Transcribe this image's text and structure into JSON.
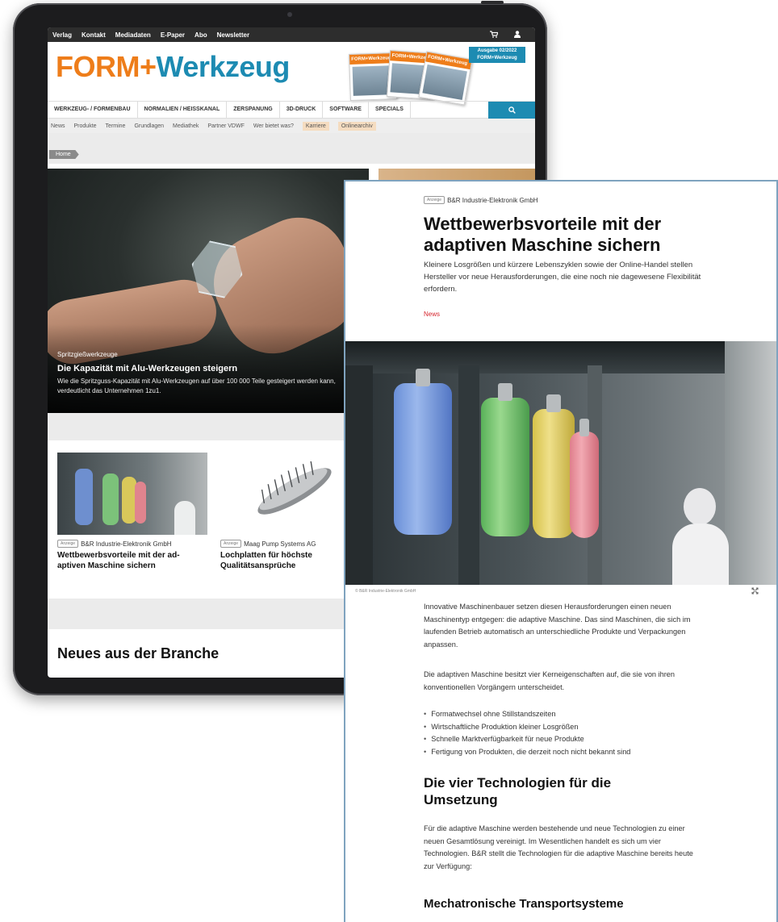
{
  "site": {
    "topnav": [
      "Verlag",
      "Kontakt",
      "Mediadaten",
      "E-Paper",
      "Abo",
      "Newsletter"
    ],
    "cart_icon": "cart-icon",
    "user_icon": "user-icon",
    "logo_form": "FORM+",
    "logo_werkzeug": "Werkzeug",
    "magazine_title": "FORM+Werkzeug",
    "issue_line1": "Ausgabe 02/2022",
    "issue_line2": "FORM+Werkzeug",
    "mainnav": [
      "WERKZEUG- / FORMENBAU",
      "NORMALIEN / HEISSKANAL",
      "ZERSPANUNG",
      "3D-DRUCK",
      "SOFTWARE",
      "SPECIALS"
    ],
    "search_icon": "search-icon",
    "subnav": [
      "News",
      "Produkte",
      "Termine",
      "Grundlagen",
      "Mediathek",
      "Partner VDWF",
      "Wer bietet was?",
      "Karriere",
      "Onlinearchiv"
    ],
    "breadcrumb": "Home",
    "hero": {
      "category": "Spritzgießwerkzeuge",
      "title": "Die Kapazität mit Alu-Werkzeugen steigern",
      "desc": "Wie die Spritzguss-Kapazität mit Alu-Werkzeugen auf über 100 000 Teile gesteigert werden kann, verdeutlicht das Unternehmen 1zu1."
    },
    "cards": [
      {
        "tag": "Anzeige",
        "company": "B&R Industrie-Elektronik GmbH",
        "title": "Wettbewerbsvorteile mit der ad-aptiven Maschine sichern"
      },
      {
        "tag": "Anzeige",
        "company": "Maag Pump Systems AG",
        "title": "Lochplatten für höchste Qualitätsansprüche"
      }
    ],
    "section_title": "Neues aus der Branche"
  },
  "article": {
    "tag": "Anzeige",
    "company": "B&R Industrie-Elektronik GmbH",
    "title": "Wettbewerbsvorteile mit der adaptiven Maschine sichern",
    "lead": "Kleinere Losgrößen und kürzere Lebenszyklen sowie der Online-Handel stellen Hersteller vor neue Herausforderungen, die eine noch nie dagewesene Flexibilität erfordern.",
    "category": "News",
    "image_credit": "© B&R Industrie-Elektronik GmbH",
    "expand_icon": "expand-icon",
    "p1": "Innovative Maschinenbauer setzen diesen Herausforderungen einen neuen Maschinentyp entgegen: die adaptive Maschine. Das sind Maschinen, die sich im laufenden Betrieb automatisch an unterschiedliche Produkte und Verpackungen anpassen.",
    "p2": "Die adaptiven Maschine besitzt vier Kerneigenschaften auf, die sie von ihren konventionellen Vorgängern unterscheidet.",
    "bullets": [
      "Formatwechsel ohne Stillstandszeiten",
      "Wirtschaftliche Produktion kleiner Losgrößen",
      "Schnelle Marktverfügbarkeit für neue Produkte",
      "Fertigung von Produkten, die derzeit noch nicht bekannt sind"
    ],
    "h2": "Die vier Technologien für die Umsetzung",
    "p3": "Für die adaptive Maschine werden bestehende und neue Technologien zu einer neuen Gesamtlösung vereinigt. Im Wesentlichen handelt es sich um vier Technologien. B&R stellt die Technologien für die adaptive Maschine bereits heute zur Verfügung:",
    "h3": "Mechatronische Transportsysteme"
  },
  "colors": {
    "brand_orange": "#ee7d1a",
    "brand_blue": "#1d8bb2",
    "news_red": "#d6262e",
    "frame_border": "#7fa3bf"
  }
}
